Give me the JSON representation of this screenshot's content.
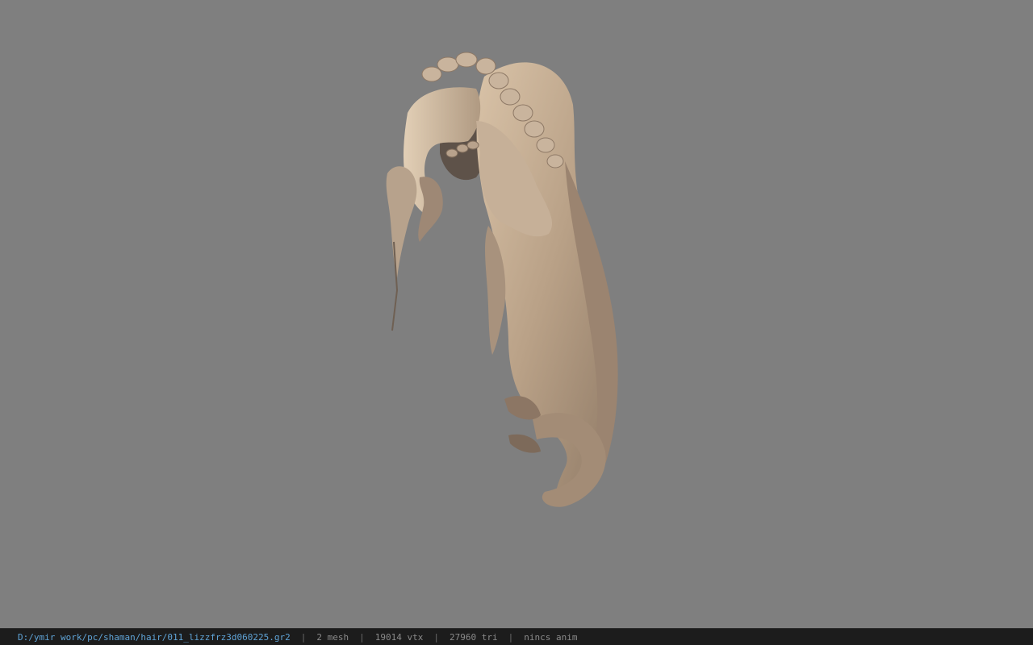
{
  "viewport": {
    "background": "#7f7f7f",
    "model": "hair-model"
  },
  "statusbar": {
    "path": "D:/ymir work/pc/shaman/hair/011_lizzfrz3d060225.gr2",
    "mesh": "2 mesh",
    "vtx": "19014 vtx",
    "tri": "27960 tri",
    "anim": "nincs anim",
    "separator": "|",
    "path_color": "#5fa3d6"
  }
}
